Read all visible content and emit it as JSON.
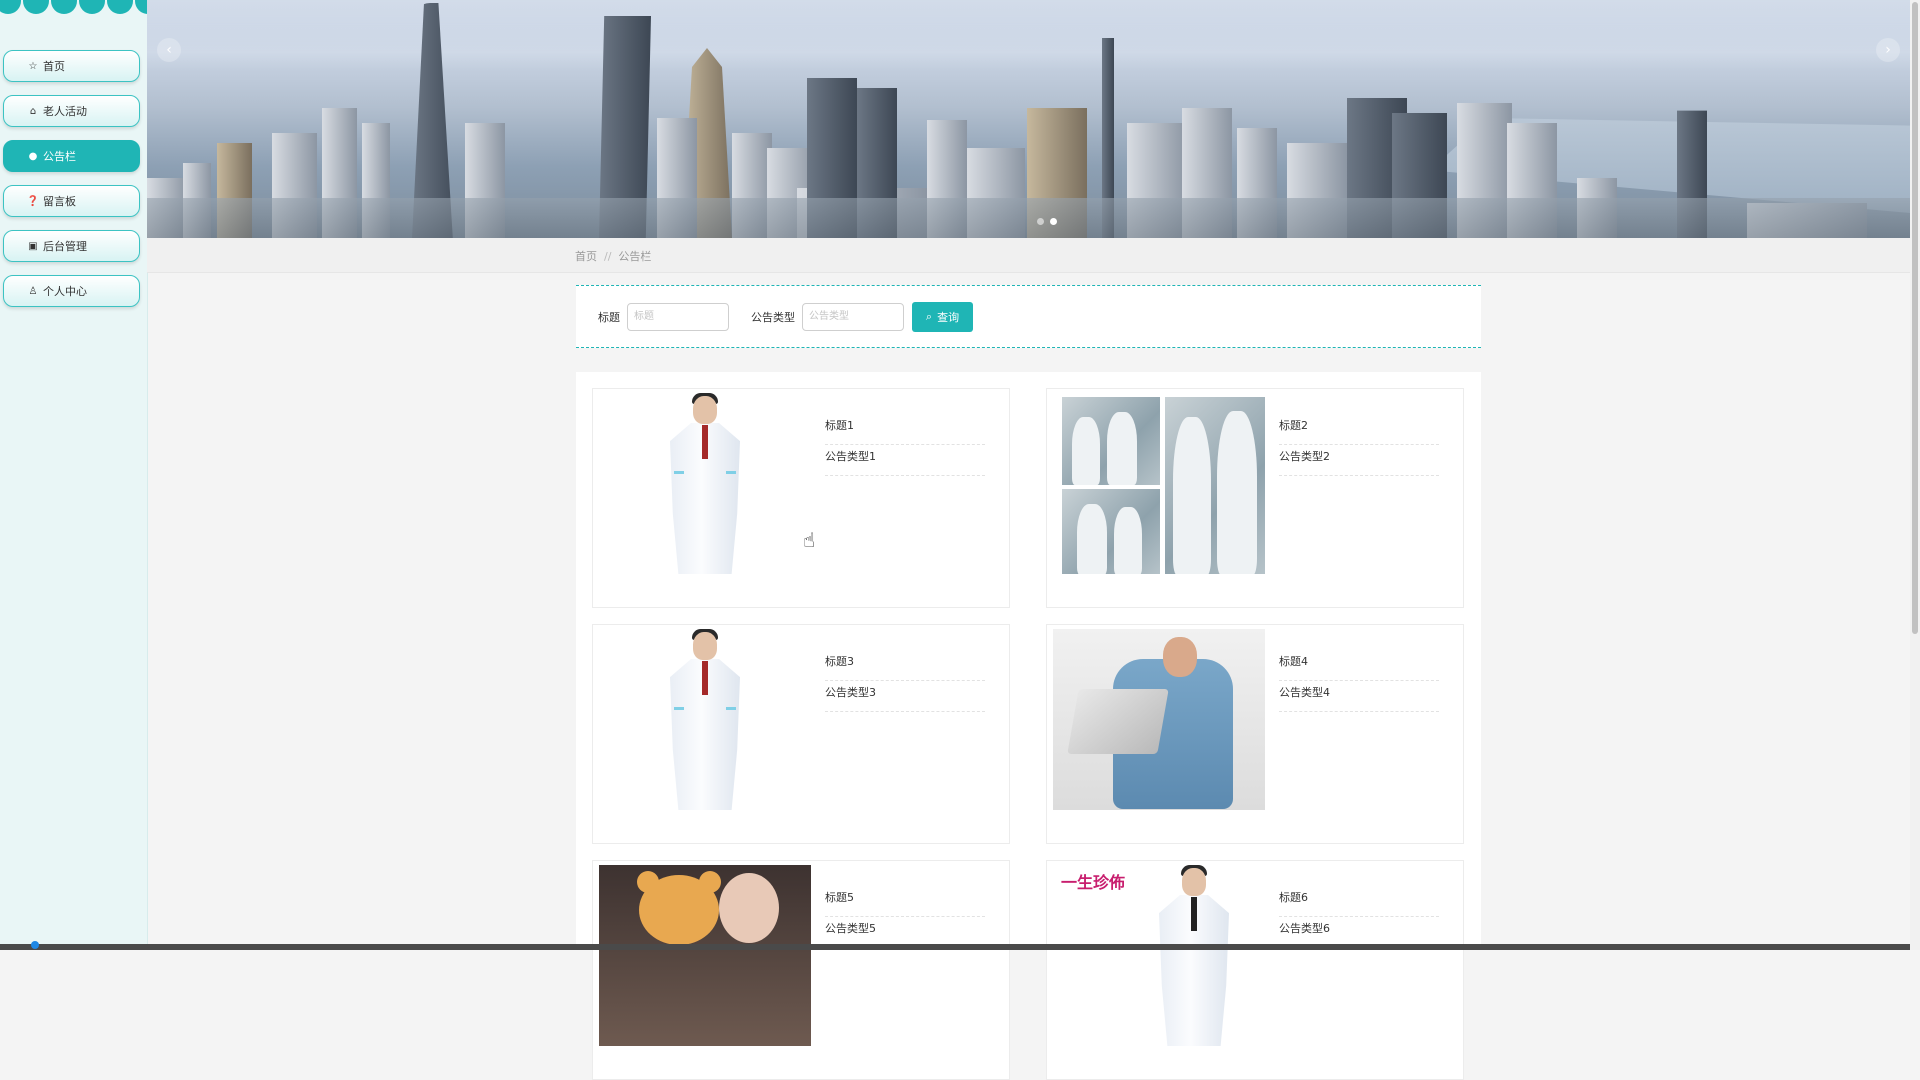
{
  "sidebar": {
    "items": [
      {
        "label": "首页",
        "icon": "star-icon",
        "active": false
      },
      {
        "label": "老人活动",
        "icon": "bag-icon",
        "active": false
      },
      {
        "label": "公告栏",
        "icon": "info-circle-icon",
        "active": true
      },
      {
        "label": "留言板",
        "icon": "question-circle-icon",
        "active": false
      },
      {
        "label": "后台管理",
        "icon": "printer-icon",
        "active": false
      },
      {
        "label": "个人中心",
        "icon": "user-icon",
        "active": false
      }
    ]
  },
  "banner": {
    "prev_label": "‹",
    "next_label": "›",
    "slides": 2,
    "active_slide": 1
  },
  "breadcrumb": {
    "home": "首页",
    "separator": "//",
    "current": "公告栏"
  },
  "search": {
    "title_label": "标题",
    "title_placeholder": "标题",
    "type_label": "公告类型",
    "type_placeholder": "公告类型",
    "button_label": "查询"
  },
  "cards": [
    {
      "title": "标题1",
      "type": "公告类型1",
      "image": "doctor-white-coat"
    },
    {
      "title": "标题2",
      "type": "公告类型2",
      "image": "medical-staff-ppe"
    },
    {
      "title": "标题3",
      "type": "公告类型3",
      "image": "doctor-white-coat"
    },
    {
      "title": "标题4",
      "type": "公告类型4",
      "image": "doctor-laptop"
    },
    {
      "title": "标题5",
      "type": "公告类型5",
      "image": "bear-mascot"
    },
    {
      "title": "标题6",
      "type": "公告类型6",
      "image": "brand-doctor"
    }
  ],
  "colors": {
    "accent": "#1fb5b5",
    "sidebar_bg": "#e9f6f6",
    "page_bg": "#f4f4f4"
  }
}
